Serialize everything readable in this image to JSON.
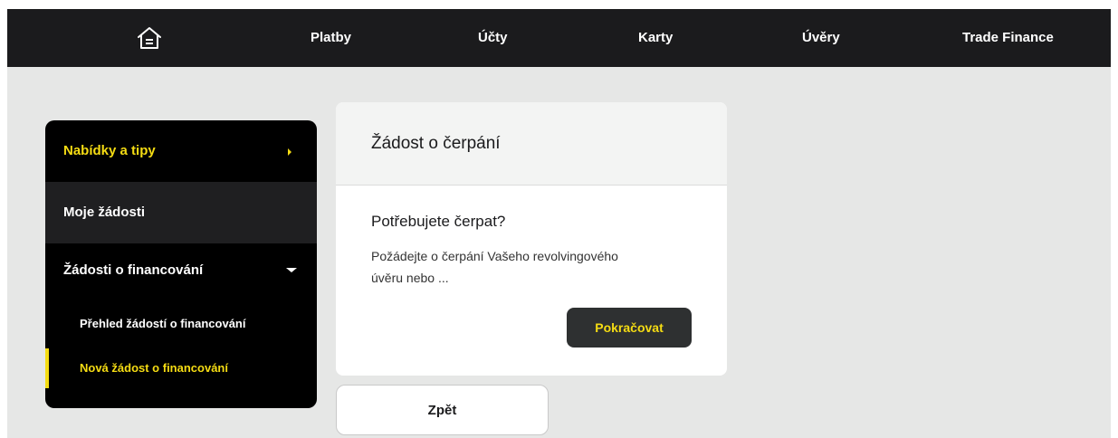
{
  "nav": {
    "home_icon": "home-icon",
    "items": [
      {
        "label": "Platby"
      },
      {
        "label": "Účty"
      },
      {
        "label": "Karty"
      },
      {
        "label": "Úvěry"
      },
      {
        "label": "Trade Finance"
      }
    ]
  },
  "sidebar": {
    "offers": "Nabídky a tipy",
    "my_requests": "Moje žádosti",
    "financing_requests": "Žádosti o financování",
    "sub_items": [
      {
        "label": "Přehled žádostí o financování"
      },
      {
        "label": "Nová žádost o financování"
      }
    ]
  },
  "card": {
    "title": "Žádost o čerpání",
    "subtitle": "Potřebujete čerpat?",
    "text": "Požádejte o čerpání Vašeho revolvingového úvěru nebo ...",
    "continue_label": "Pokračovat"
  },
  "back_label": "Zpět",
  "colors": {
    "accent": "#f5dc13",
    "dark": "#1b1b1d",
    "background": "#e6e7e6"
  }
}
